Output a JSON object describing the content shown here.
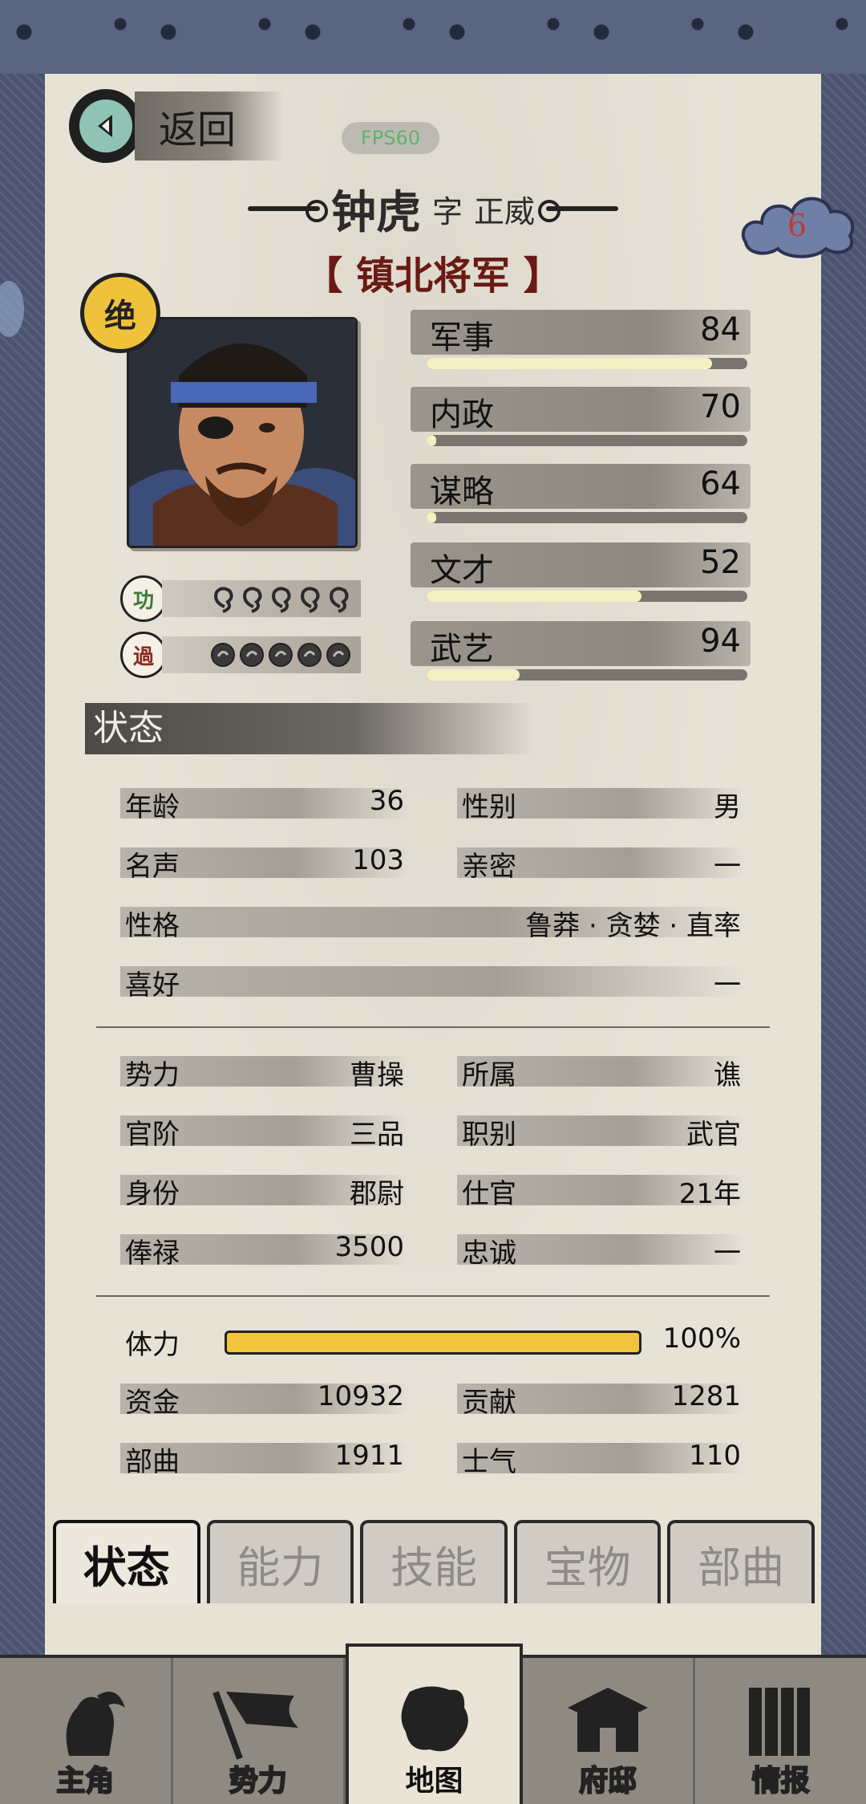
{
  "header": {
    "back_label": "返回",
    "fps": "FPS60"
  },
  "character": {
    "name": "钟虎",
    "zi_label": "字",
    "courtesy_name": "正威",
    "title": "【 镇北将军 】",
    "rank_badge": "绝",
    "cloud_number": "6",
    "merit_label": "功",
    "demerit_label": "過"
  },
  "attributes": [
    {
      "label": "军事",
      "value": "84",
      "progress": 0.89
    },
    {
      "label": "内政",
      "value": "70",
      "progress": 0.03
    },
    {
      "label": "谋略",
      "value": "64",
      "progress": 0.03
    },
    {
      "label": "文才",
      "value": "52",
      "progress": 0.67
    },
    {
      "label": "武艺",
      "value": "94",
      "progress": 0.29
    }
  ],
  "section_title": "状态",
  "status": {
    "age": {
      "label": "年龄",
      "value": "36"
    },
    "gender": {
      "label": "性别",
      "value": "男"
    },
    "fame": {
      "label": "名声",
      "value": "103"
    },
    "intimacy": {
      "label": "亲密",
      "value": "一"
    },
    "personality": {
      "label": "性格",
      "value": "鲁莽 · 贪婪 · 直率"
    },
    "hobby": {
      "label": "喜好",
      "value": "一"
    },
    "faction": {
      "label": "势力",
      "value": "曹操"
    },
    "belong": {
      "label": "所属",
      "value": "谯"
    },
    "rank": {
      "label": "官阶",
      "value": "三品"
    },
    "position": {
      "label": "职别",
      "value": "武官"
    },
    "identity": {
      "label": "身份",
      "value": "郡尉"
    },
    "service": {
      "label": "仕官",
      "value": "21年"
    },
    "salary": {
      "label": "俸禄",
      "value": "3500"
    },
    "loyalty": {
      "label": "忠诚",
      "value": "一"
    },
    "stamina": {
      "label": "体力",
      "value": "100%",
      "progress": 1.0
    },
    "funds": {
      "label": "资金",
      "value": "10932"
    },
    "contribution": {
      "label": "贡献",
      "value": "1281"
    },
    "troops": {
      "label": "部曲",
      "value": "1911"
    },
    "morale": {
      "label": "士气",
      "value": "110"
    }
  },
  "tabs": [
    "状态",
    "能力",
    "技能",
    "宝物",
    "部曲"
  ],
  "nav": [
    "主角",
    "势力",
    "地图",
    "府邸",
    "情报"
  ],
  "colors": {
    "title_red": "#6a1a14",
    "stamina": "#f2c33c",
    "paper": "#e7e2d6"
  }
}
